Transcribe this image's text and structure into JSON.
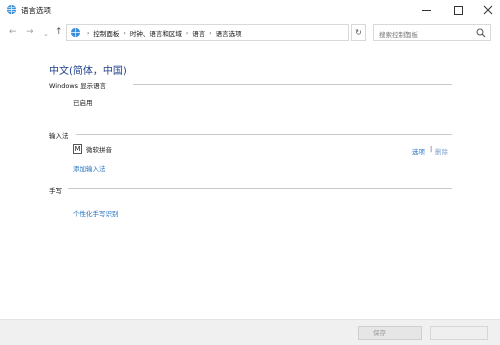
{
  "window": {
    "title": "语言选项"
  },
  "nav": {
    "breadcrumbs": [
      "控制面板",
      "时钟、语言和区域",
      "语言",
      "语言选项"
    ],
    "search_placeholder": "搜索控制面板"
  },
  "page": {
    "title": "中文(简体，中国)",
    "display_language": {
      "heading": "Windows 显示语言",
      "status": "已启用"
    },
    "input_methods": {
      "heading": "输入法",
      "items": [
        {
          "icon_letter": "M",
          "name": "微软拼音",
          "options_label": "选项",
          "separator": "|",
          "remove_label": "删除"
        }
      ],
      "add_label": "添加输入法"
    },
    "handwriting": {
      "heading": "手写",
      "personalize_label": "个性化手写识别"
    }
  },
  "footer": {
    "save_label": "保存"
  },
  "colors": {
    "accent": "#1e3f8a",
    "link": "#1f6fbf",
    "divider": "#c9c9c9"
  }
}
